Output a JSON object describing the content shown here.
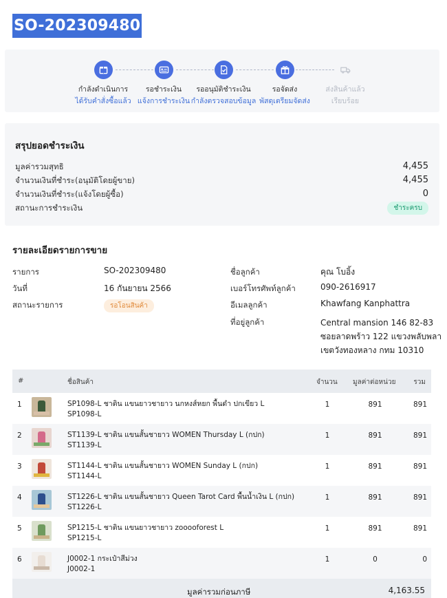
{
  "order": {
    "id": "SO-202309480"
  },
  "colors": {
    "accent": "#3f6fd8",
    "paid_badge_bg": "#d3f6ea",
    "paid_badge_text": "#1b9a70",
    "wait_badge_bg": "#fdeede",
    "wait_badge_text": "#e08a3b",
    "inactive": "#b5bac4"
  },
  "steps": [
    {
      "icon": "package-icon",
      "title": "กำลังดำเนินการ",
      "sub": "ได้รับคำสั่งซื้อแล้ว",
      "active": true
    },
    {
      "icon": "payment-card-icon",
      "title": "รอชำระเงิน",
      "sub": "แจ้งการชำระเงิน",
      "active": true
    },
    {
      "icon": "document-check-icon",
      "title": "รออนุมัติชำระเงิน",
      "sub": "กำลังตรวจสอบข้อมูล",
      "active": true
    },
    {
      "icon": "gift-box-icon",
      "title": "รอจัดส่ง",
      "sub": "พัสดุเตรียมจัดส่ง",
      "active": true
    },
    {
      "icon": "truck-icon",
      "title": "ส่งสินค้าแล้ว",
      "sub": "เรียบร้อย",
      "active": false
    }
  ],
  "payment": {
    "title": "สรุปยอดชำระเงิน",
    "net_total_label": "มูลค่ารวมสุทธิ",
    "net_total": "4,455",
    "approved_label": "จำนวนเงินที่ชำระ(อนุมัติโดยผู้ขาย)",
    "approved": "4,455",
    "reported_label": "จำนวนเงินที่ชำระ(แจ้งโดยผู้ซื้อ)",
    "reported": "0",
    "status_label": "สถานะการชำระเงิน",
    "status": "ชำระครบ"
  },
  "details": {
    "title": "รายละเอียดรายการขาย",
    "item_label": "รายการ",
    "item": "SO-202309480",
    "date_label": "วันที่",
    "date": "16 กันยายน 2566",
    "status_label": "สถานะรายการ",
    "status": "รอโอนสินค้า",
    "customer_label": "ชื่อลูกค้า",
    "customer": "คุณ โบอิ้ง",
    "phone_label": "เบอร์โทรศัพท์ลูกค้า",
    "phone": "090-2616917",
    "email_label": "อีเมลลูกค้า",
    "email": "Khawfang Kanphattra",
    "address_label": "ที่อยู่ลูกค้า",
    "address": [
      "Central mansion 146 82-83",
      "ซอยลาดพร้าว 122 แขวงพลับพลา",
      "เขตวังทองหลาง กทม 10310"
    ]
  },
  "table": {
    "headers": {
      "num": "#",
      "name": "ชื่อสินค้า",
      "qty": "จำนวน",
      "unit": "มูลค่าต่อหน่วย",
      "total": "รวม"
    },
    "rows": [
      {
        "num": "1",
        "name": "SP1098-L ชาติน แขนยาวชายาว นกหงส์หยก พื้นดำ ปกเขียว L",
        "sku": "SP1098-L",
        "qty": "1",
        "unit": "891",
        "total": "891",
        "thumb": [
          "#c9b79a",
          "#3c5a3a",
          "#d8c0a8"
        ]
      },
      {
        "num": "2",
        "name": "ST1139-L ชาติน แขนสั้นชายาว WOMEN Thursday L (กปก)",
        "sku": "ST1139-L",
        "qty": "1",
        "unit": "891",
        "total": "891",
        "thumb": [
          "#e8d6d0",
          "#d46a8a",
          "#7aa96a"
        ]
      },
      {
        "num": "3",
        "name": "ST1144-L ชาติน แขนสั้นชายาว WOMEN Sunday L (กปก)",
        "sku": "ST1144-L",
        "qty": "1",
        "unit": "891",
        "total": "891",
        "thumb": [
          "#efe5dc",
          "#c24a3a",
          "#e0b640"
        ]
      },
      {
        "num": "4",
        "name": "ST1226-L ชาติน แขนสั้นชายาว Queen Tarot Card พื้นน้ำเงิน L (กปก)",
        "sku": "ST1226-L",
        "qty": "1",
        "unit": "891",
        "total": "891",
        "thumb": [
          "#a8c7d6",
          "#2e4f8c",
          "#e6c79a"
        ]
      },
      {
        "num": "5",
        "name": "SP1215-L ชาติน แขนยาวชายาว zooooforest L",
        "sku": "SP1215-L",
        "qty": "1",
        "unit": "891",
        "total": "891",
        "thumb": [
          "#d9e0cc",
          "#6f9a5e",
          "#c9b38a"
        ]
      },
      {
        "num": "6",
        "name": "J0002-1 กระเป๋าสีม่วง",
        "sku": "J0002-1",
        "qty": "1",
        "unit": "0",
        "total": "0",
        "thumb": [
          "#f2efec",
          "#e7dcd2",
          "#c9b8a8"
        ]
      }
    ],
    "footer_label": "มูลค่ารวมก่อนภาษี",
    "footer_value": "4,163.55"
  }
}
